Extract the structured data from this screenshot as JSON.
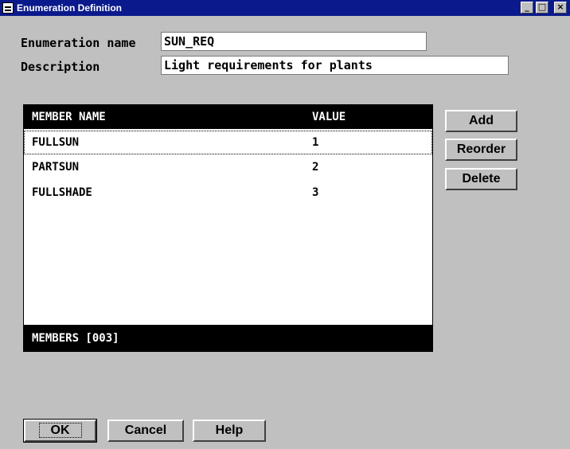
{
  "window": {
    "title": "Enumeration Definition",
    "controls": {
      "minimize": "_",
      "maximize": "□",
      "close": "×"
    }
  },
  "form": {
    "name_label": "Enumeration name",
    "name_value": "SUN_REQ",
    "description_label": "Description",
    "description_value": "Light requirements for plants"
  },
  "members": {
    "columns": [
      "MEMBER NAME",
      "VALUE"
    ],
    "rows": [
      {
        "name": "FULLSUN",
        "value": "1"
      },
      {
        "name": "PARTSUN",
        "value": "2"
      },
      {
        "name": "FULLSHADE",
        "value": "3"
      }
    ],
    "footer": "MEMBERS [003]"
  },
  "side_buttons": {
    "add": "Add",
    "reorder": "Reorder",
    "delete": "Delete"
  },
  "bottom_buttons": {
    "ok": "OK",
    "cancel": "Cancel",
    "help": "Help"
  }
}
